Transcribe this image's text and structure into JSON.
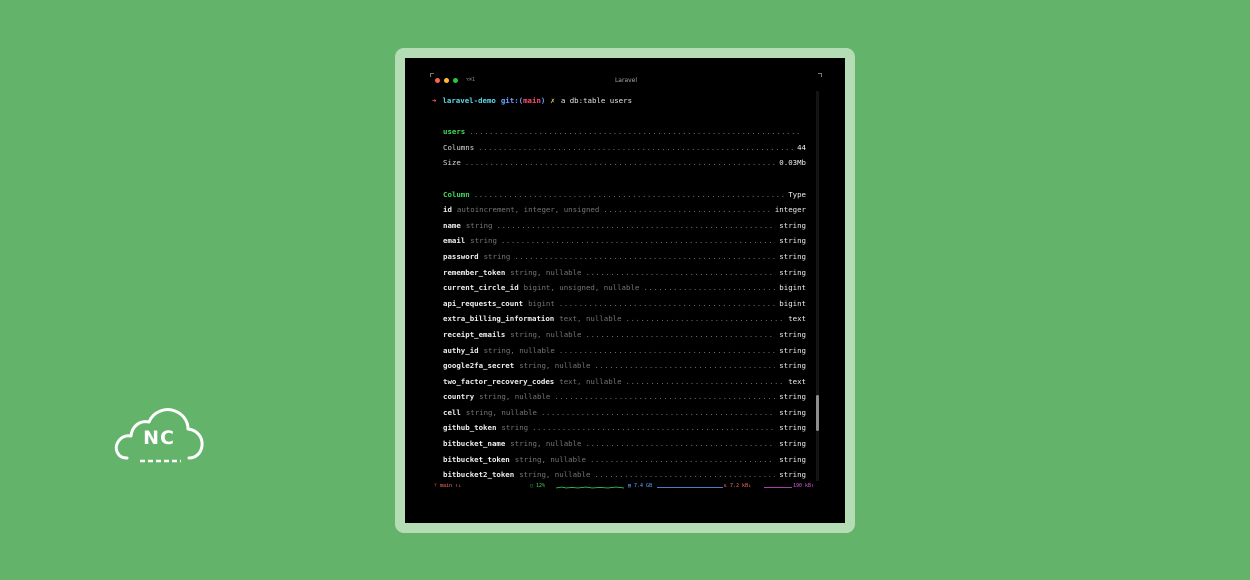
{
  "logo": {
    "text": "NC"
  },
  "window": {
    "title": "Laravel",
    "shortcut": "⌥⌘1",
    "traffic_colors": [
      "#ff5f57",
      "#febc2e",
      "#28c840"
    ]
  },
  "prompt": {
    "arrow": "➜",
    "dir": "laravel-demo",
    "git_label": "git:(",
    "branch": "main",
    "git_close": ")",
    "dirty_mark": "✗",
    "command": "a db:table users"
  },
  "table_info": [
    {
      "key": "users",
      "value": ""
    },
    {
      "key": "Columns",
      "value": "44"
    },
    {
      "key": "Size",
      "value": "0.03Mb"
    }
  ],
  "column_header": {
    "key": "Column",
    "value": "Type"
  },
  "columns": [
    {
      "name": "id",
      "attrs": "autoincrement, integer, unsigned",
      "type": "integer"
    },
    {
      "name": "name",
      "attrs": "string",
      "type": "string"
    },
    {
      "name": "email",
      "attrs": "string",
      "type": "string"
    },
    {
      "name": "password",
      "attrs": "string",
      "type": "string"
    },
    {
      "name": "remember_token",
      "attrs": "string, nullable",
      "type": "string"
    },
    {
      "name": "current_circle_id",
      "attrs": "bigint, unsigned, nullable",
      "type": "bigint"
    },
    {
      "name": "api_requests_count",
      "attrs": "bigint",
      "type": "bigint"
    },
    {
      "name": "extra_billing_information",
      "attrs": "text, nullable",
      "type": "text"
    },
    {
      "name": "receipt_emails",
      "attrs": "string, nullable",
      "type": "string"
    },
    {
      "name": "authy_id",
      "attrs": "string, nullable",
      "type": "string"
    },
    {
      "name": "google2fa_secret",
      "attrs": "string, nullable",
      "type": "string"
    },
    {
      "name": "two_factor_recovery_codes",
      "attrs": "text, nullable",
      "type": "text"
    },
    {
      "name": "country",
      "attrs": "string, nullable",
      "type": "string"
    },
    {
      "name": "cell",
      "attrs": "string, nullable",
      "type": "string"
    },
    {
      "name": "github_token",
      "attrs": "string",
      "type": "string"
    },
    {
      "name": "bitbucket_name",
      "attrs": "string, nullable",
      "type": "string"
    },
    {
      "name": "bitbucket_token",
      "attrs": "string, nullable",
      "type": "string"
    },
    {
      "name": "bitbucket2_token",
      "attrs": "string, nullable",
      "type": "string"
    }
  ],
  "statusbar": {
    "branch": "ᛘ main ↑↓",
    "cpu": "▢ 12%",
    "mem": "▤ 7.4 GB",
    "net": "⇅ 7.2 kB↓",
    "rate": "190 kB↑"
  }
}
